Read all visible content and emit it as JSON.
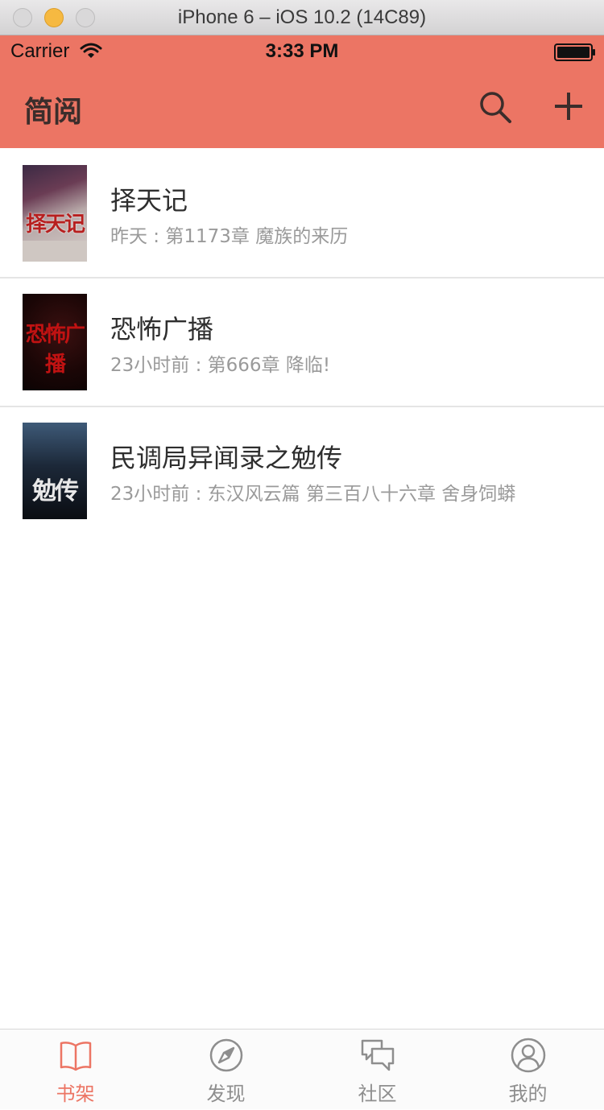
{
  "window": {
    "title": "iPhone 6 – iOS 10.2 (14C89)"
  },
  "status_bar": {
    "carrier": "Carrier",
    "time": "3:33 PM"
  },
  "nav": {
    "title": "简阅"
  },
  "books": [
    {
      "title": "择天记",
      "subtitle": "昨天 : 第1173章 魔族的来历",
      "cover_text": "择天记"
    },
    {
      "title": "恐怖广播",
      "subtitle": "23小时前 : 第666章 降临!",
      "cover_text": "恐怖广播"
    },
    {
      "title": "民调局异闻录之勉传",
      "subtitle": "23小时前 : 东汉风云篇 第三百八十六章  舍身饲蟒",
      "cover_text": "勉传"
    }
  ],
  "tabs": [
    {
      "label": "书架",
      "icon": "book-icon",
      "active": true
    },
    {
      "label": "发现",
      "icon": "compass-icon",
      "active": false
    },
    {
      "label": "社区",
      "icon": "chat-bubbles-icon",
      "active": false
    },
    {
      "label": "我的",
      "icon": "user-icon",
      "active": false
    }
  ],
  "colors": {
    "accent": "#ec7564",
    "tab_inactive": "#8e8e8e"
  }
}
